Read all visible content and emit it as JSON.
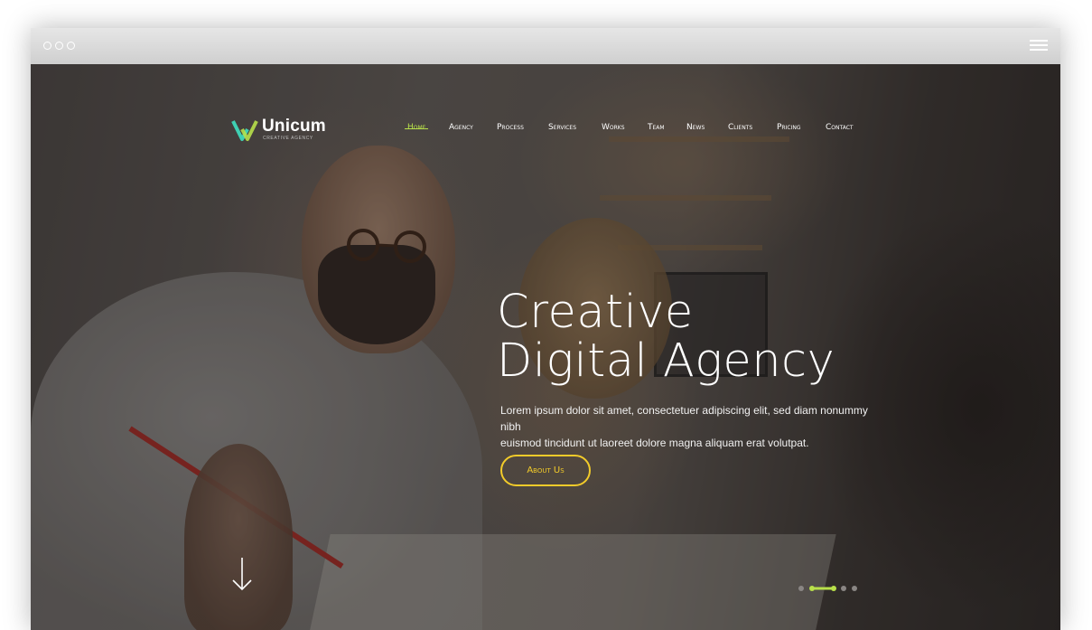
{
  "browser": {
    "window_controls": [
      "dot-icon",
      "dot-icon",
      "dot-icon"
    ],
    "menu_icon": "hamburger-icon"
  },
  "brand": {
    "name": "Unicum",
    "tagline": "CREATIVE AGENCY",
    "accent": "#b8e04a",
    "logo_colors": [
      "#3fd0b3",
      "#b8e04a"
    ]
  },
  "nav": {
    "items": [
      {
        "label": "Home",
        "active": true
      },
      {
        "label": "Agency",
        "active": false
      },
      {
        "label": "Process",
        "active": false
      },
      {
        "label": "Services",
        "active": false
      },
      {
        "label": "Works",
        "active": false
      },
      {
        "label": "Team",
        "active": false
      },
      {
        "label": "News",
        "active": false
      },
      {
        "label": "Clients",
        "active": false
      },
      {
        "label": "Pricing",
        "active": false
      },
      {
        "label": "Contact",
        "active": false
      }
    ]
  },
  "hero": {
    "headline_line1": "Creative",
    "headline_line2": "Digital Agency",
    "body_line1": "Lorem ipsum dolor sit amet, consectetuer adipiscing elit, sed diam nonummy nibh",
    "body_line2": "euismod tincidunt ut laoreet dolore magna aliquam erat volutpat.",
    "cta_label": "About Us",
    "cta_color": "#f2cb2a",
    "scroll_icon": "arrow-down-icon"
  },
  "slider": {
    "total_slides": 4,
    "active_slide": 2
  }
}
